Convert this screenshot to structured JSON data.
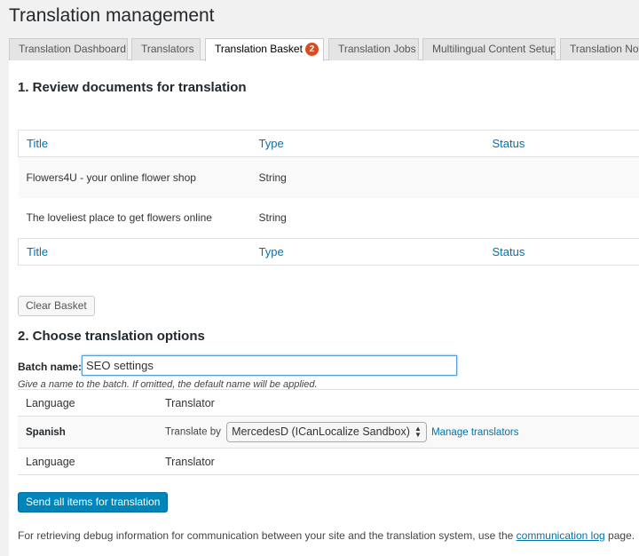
{
  "page_title": "Translation management",
  "tabs": [
    {
      "label": "Translation Dashboard"
    },
    {
      "label": "Translators"
    },
    {
      "label": "Translation Basket",
      "badge": "2"
    },
    {
      "label": "Translation Jobs"
    },
    {
      "label": "Multilingual Content Setup"
    },
    {
      "label": "Translation Notifications"
    }
  ],
  "section1": {
    "title": "1. Review documents for translation",
    "columns": [
      "Title",
      "Type",
      "Status"
    ],
    "rows": [
      {
        "title": "Flowers4U - your online flower shop",
        "type": "String",
        "status": ""
      },
      {
        "title": "The loveliest place to get flowers online",
        "type": "String",
        "status": ""
      }
    ],
    "clear_button": "Clear Basket"
  },
  "section2": {
    "title": "2. Choose translation options",
    "batch_label": "Batch name:",
    "batch_value": "SEO settings",
    "batch_hint": "Give a name to the batch. If omitted, the default name will be applied.",
    "col_language": "Language",
    "col_translator": "Translator",
    "language": "Spanish",
    "translate_by_label": "Translate by",
    "translator_selected": "MercedesD (ICanLocalize Sandbox)",
    "manage_link": "Manage translators",
    "send_button": "Send all items for translation"
  },
  "footer": {
    "text_before": "For retrieving debug information for communication between your site and the translation system, use the",
    "link": "communication log",
    "text_after": "page."
  },
  "colors": {
    "accent": "#0073aa",
    "primary_button": "#0085ba",
    "badge": "#d54e21"
  }
}
